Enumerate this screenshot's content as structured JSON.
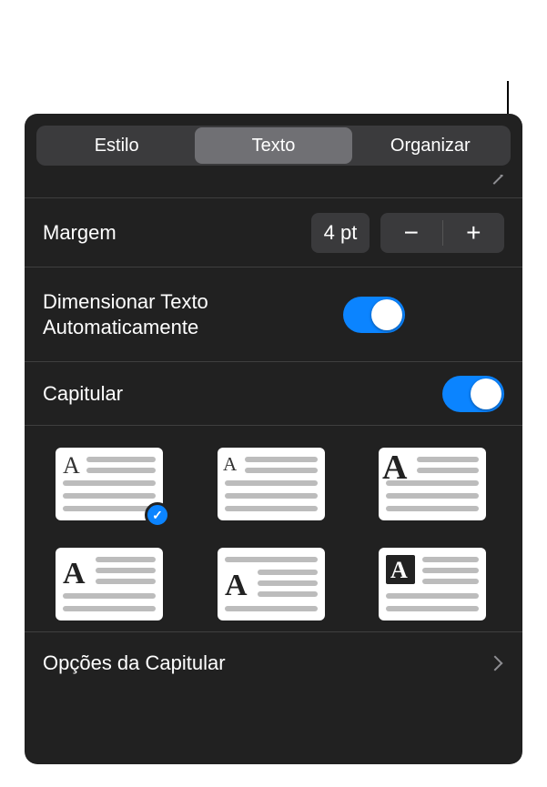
{
  "tabs": {
    "style": "Estilo",
    "text": "Texto",
    "arrange": "Organizar",
    "active_index": 1
  },
  "margin": {
    "label": "Margem",
    "value": "4 pt"
  },
  "autosize": {
    "label": "Dimensionar Texto Automaticamente",
    "on": true
  },
  "dropcap": {
    "label": "Capitular",
    "on": true,
    "options_label": "Opções da Capitular",
    "styles": [
      {
        "id": "raised-small",
        "selected": true
      },
      {
        "id": "raised-medium",
        "selected": false
      },
      {
        "id": "raised-large",
        "selected": false
      },
      {
        "id": "drop-2line",
        "selected": false
      },
      {
        "id": "drop-3line",
        "selected": false
      },
      {
        "id": "boxed",
        "selected": false
      }
    ]
  },
  "colors": {
    "accent": "#0b84ff",
    "panel_bg": "#212121",
    "segmented_bg": "#3b3b3d",
    "segmented_active": "#707074",
    "field_bg": "#3a3a3c",
    "separator": "#3f3f3f"
  }
}
